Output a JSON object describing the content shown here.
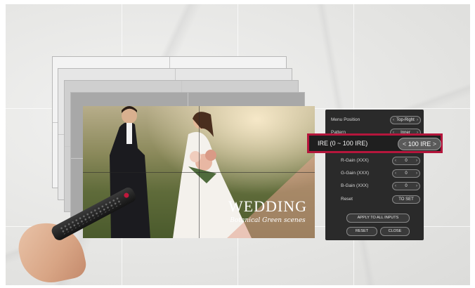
{
  "colors": {
    "accent": "#b5163c",
    "osd_bg": "#2a2a2a",
    "marble": "#e5e5e3"
  },
  "photo": {
    "title": "WEDDING",
    "subtitle": "Botanical Green scenes"
  },
  "osd_menu": {
    "menu_position": {
      "label": "Menu Position",
      "value": "Top-Right"
    },
    "pattern": {
      "label": "Pattern",
      "value": "Inner"
    },
    "r_gain": {
      "label": "R-Gain (XXX)",
      "value": "0"
    },
    "g_gain": {
      "label": "G-Gain (XXX)",
      "value": "0"
    },
    "b_gain": {
      "label": "B-Gain (XXX)",
      "value": "0"
    },
    "reset": {
      "label": "Reset",
      "button": "TO SET"
    },
    "apply_all_button": "APPLY TO ALL INPUTS",
    "reset_button": "RESET",
    "close_button": "CLOSE"
  },
  "highlight": {
    "label": "IRE (0 ~ 100 IRE)",
    "value": "100 IRE",
    "arrow_left": "<",
    "arrow_right": ">"
  },
  "icons": {
    "left_arrow": "chevron-left-icon",
    "right_arrow": "chevron-right-icon",
    "remote": "remote-control-icon"
  }
}
